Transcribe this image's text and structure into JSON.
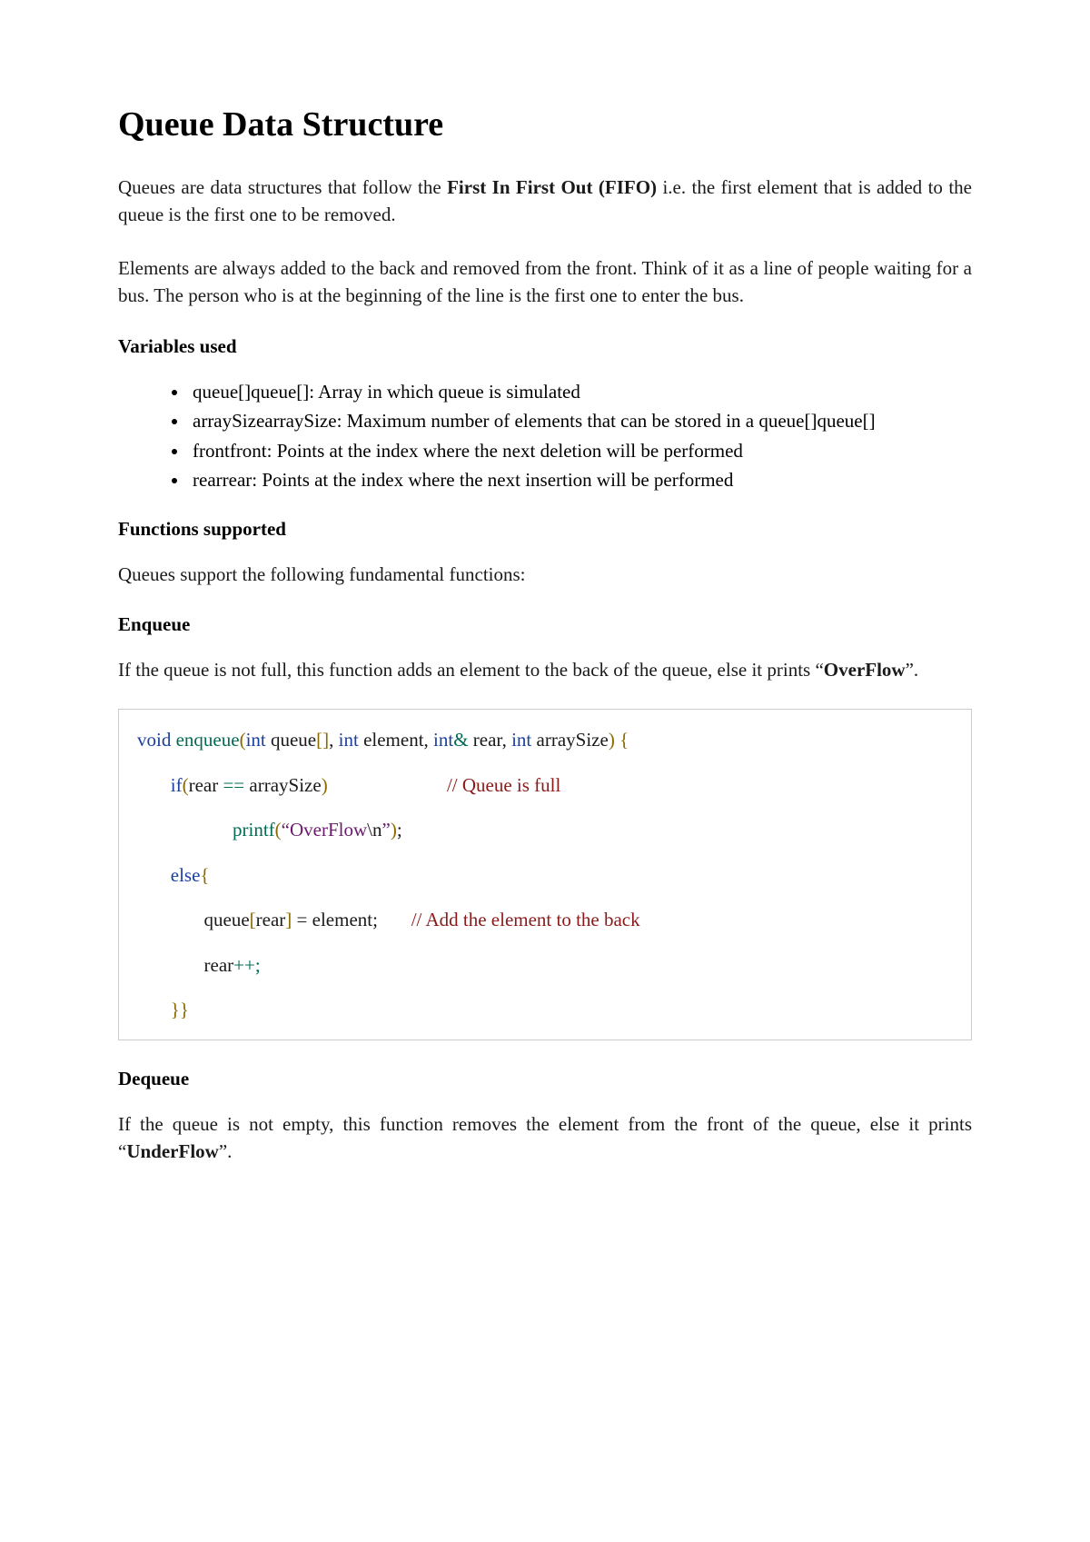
{
  "title": "Queue Data Structure",
  "para1_a": "Queues are data structures that follow the ",
  "para1_bold": "First In First Out (FIFO)",
  "para1_b": " i.e. the first element that is added to the queue is the first one to be removed.",
  "para2": "Elements are always added to the back and removed from the front. Think of it as a line of people waiting for a bus. The person who is at the beginning of the line is the first one to enter the bus.",
  "heading_variables": "Variables used",
  "vars": [
    "queue[]queue[]: Array in which queue is simulated",
    "arraySizearraySize: Maximum number of elements that can be stored in a queue[]queue[]",
    "frontfront: Points at the index where the next deletion will be performed",
    "rearrear: Points at the index where the next insertion will be performed"
  ],
  "heading_functions": "Functions supported",
  "para3": "Queues support the following fundamental functions:",
  "heading_enqueue": "Enqueue",
  "para4_a": "If the queue is not full, this function adds an element to the back of the queue, else it prints “",
  "para4_bold": "OverFlow",
  "para4_b": "”.",
  "code": {
    "l1": {
      "void": "void",
      "enqueue": " enqueue",
      "p1": "(",
      "int1": "int",
      "queue": " queue",
      "b1": "[]",
      "c1": ", ",
      "int2": "int",
      "element": " element",
      "c2": ", ",
      "int3": "int",
      "amp": "&",
      "rear": " rear",
      "c3": ", ",
      "int4": "int",
      "arraySize": " arraySize",
      "p2": ")",
      "brace": " {"
    },
    "l2": {
      "indent": "       ",
      "if": "if",
      "p1": "(",
      "rear": "rear ",
      "eq": "==",
      "arraySize": " arraySize",
      "p2": ")",
      "sp": "                         ",
      "cmt": "// Queue is full"
    },
    "l3": {
      "indent": "                    ",
      "printf": "printf",
      "p1": "(",
      "q1": "“",
      "str": "OverFlow",
      "esc": "\\n",
      "q2": "”",
      "p2": ")",
      "semi": ";"
    },
    "l4": {
      "indent": "       ",
      "else": "else",
      "brace": "{"
    },
    "l5": {
      "indent": "              ",
      "queue": "queue",
      "b1": "[",
      "rear": "rear",
      "b2": "]",
      "eq": " = ",
      "element": "element",
      "semi": ";",
      "sp": "       ",
      "cmt": "// Add the element to the back"
    },
    "l6": {
      "indent": "              ",
      "rear": "rear",
      "pp": "++;"
    },
    "l7": {
      "indent": "       ",
      "braces": "}}"
    }
  },
  "heading_dequeue": "Dequeue",
  "para5_a": "If the queue is not empty, this function removes the element from the front of the queue, else it prints “",
  "para5_bold": "UnderFlow",
  "para5_b": "”."
}
